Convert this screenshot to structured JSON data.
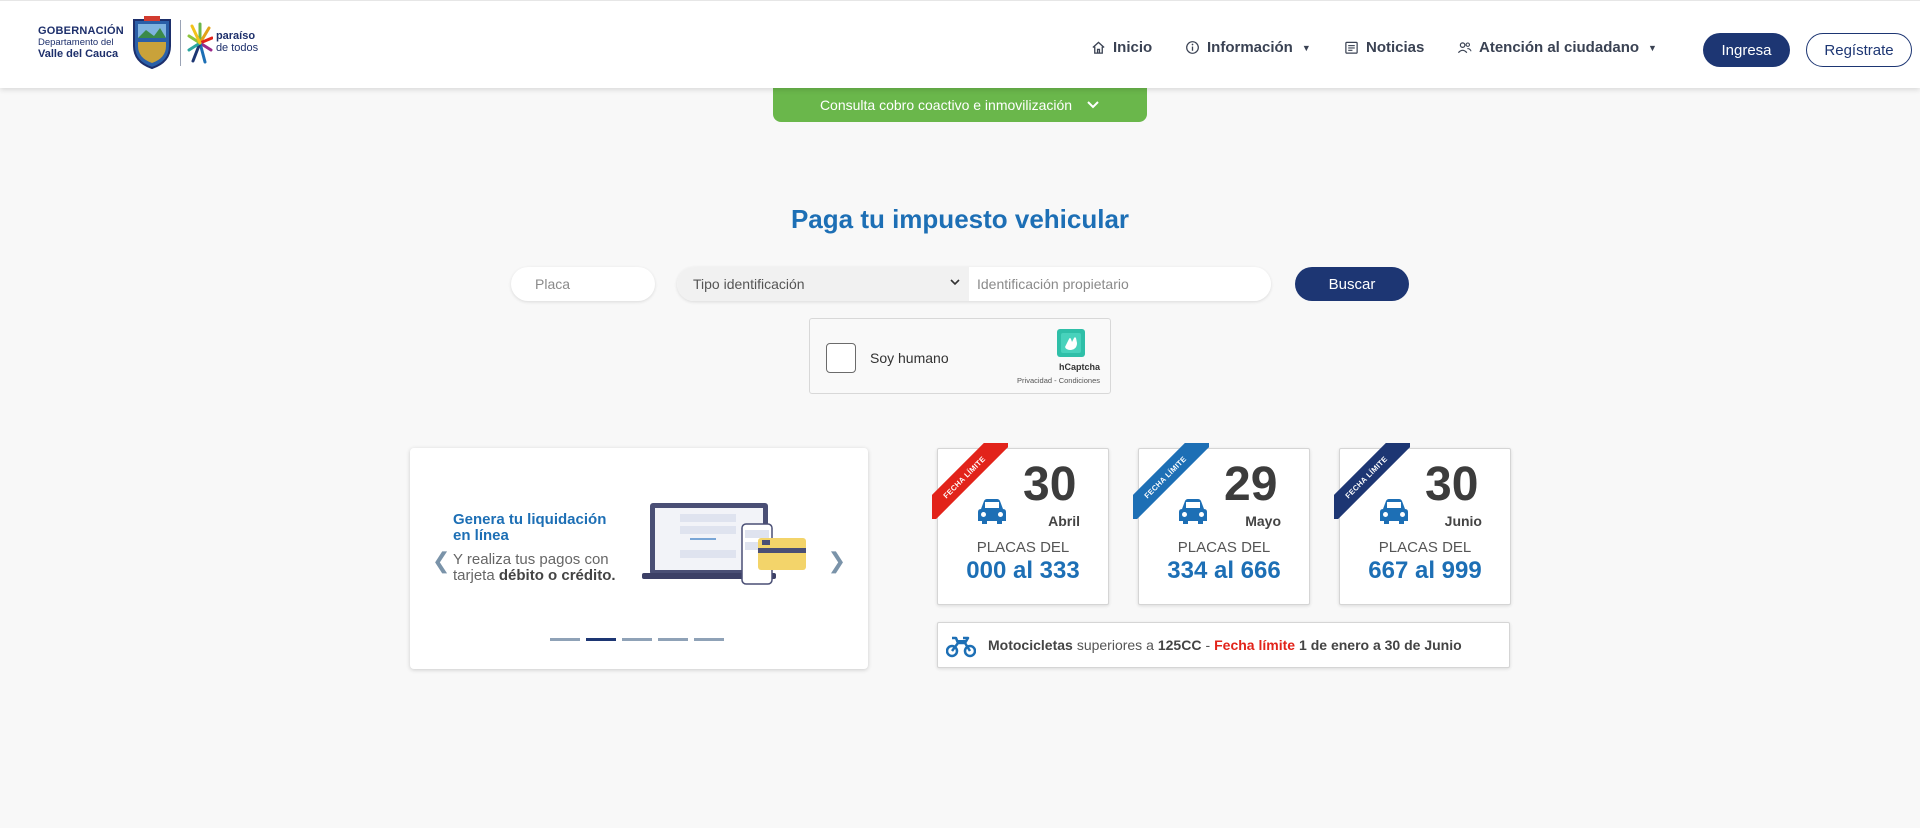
{
  "header": {
    "gov_line1": "GOBERNACIÓN",
    "gov_line2": "Departamento del",
    "gov_line3": "Valle del Cauca",
    "brand_line1": "paraíso",
    "brand_line2": "de todos",
    "nav": {
      "inicio": "Inicio",
      "informacion": "Información",
      "noticias": "Noticias",
      "atencion": "Atención al ciudadano"
    },
    "ingresa": "Ingresa",
    "registrate": "Regístrate"
  },
  "consulta_dropdown": "Consulta cobro coactivo e inmovilización",
  "search": {
    "title": "Paga tu impuesto vehicular",
    "placa_placeholder": "Placa",
    "tipo_selected": "Tipo identificación",
    "ident_placeholder": "Identificación propietario",
    "buscar": "Buscar"
  },
  "captcha": {
    "label": "Soy humano",
    "brand": "hCaptcha",
    "links": "Privacidad - Condiciones"
  },
  "carousel": {
    "title": "Genera tu liquidación en línea",
    "text_plain": "Y realiza tus pagos con tarjeta",
    "text_bold": "débito o crédito.",
    "slide_count": 5,
    "active_index": 1
  },
  "cards": [
    {
      "ribbon": "FECHA LÍMITE",
      "ribbon_color": "#e2231a",
      "day": "30",
      "month": "Abril",
      "label": "PLACAS DEL",
      "range": "000 al 333"
    },
    {
      "ribbon": "FECHA LÍMITE",
      "ribbon_color": "#1d6fb5",
      "day": "29",
      "month": "Mayo",
      "label": "PLACAS DEL",
      "range": "334 al 666"
    },
    {
      "ribbon": "FECHA LÍMITE",
      "ribbon_color": "#1d3673",
      "day": "30",
      "month": "Junio",
      "label": "PLACAS DEL",
      "range": "667 al 999"
    }
  ],
  "moto": {
    "part1": "Motocicletas",
    "part2": "superiores a",
    "part3": "125CC",
    "part4": "-",
    "part5": "Fecha límite",
    "part6": "1 de enero a 30 de Junio"
  },
  "colors": {
    "primary_dark": "#1d3673",
    "primary_blue": "#1d6fb5",
    "green": "#6ab74b",
    "red": "#e2231a"
  }
}
